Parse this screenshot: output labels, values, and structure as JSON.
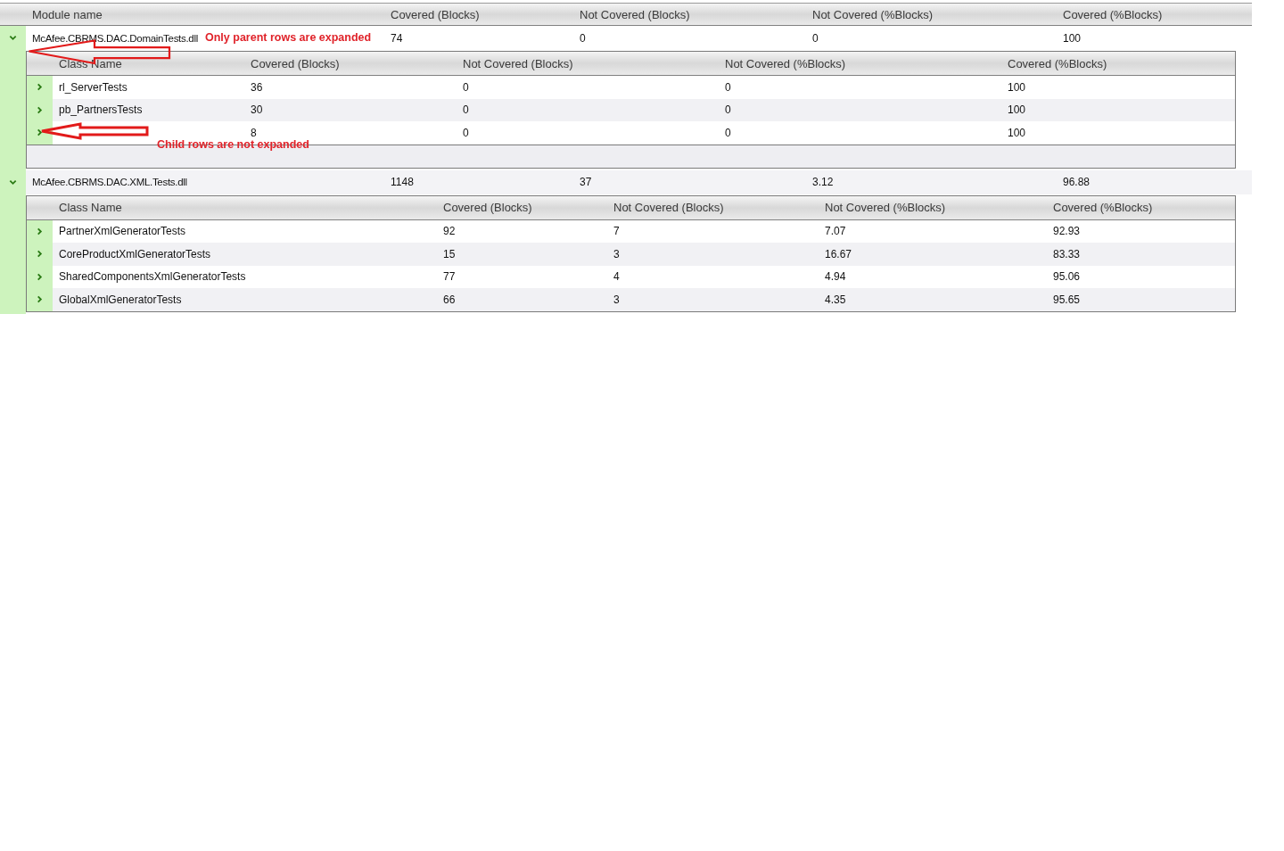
{
  "table": {
    "columns": [
      "Module name",
      "Covered (Blocks)",
      "Not Covered (Blocks)",
      "Not Covered (%Blocks)",
      "Covered (%Blocks)"
    ],
    "modules": [
      {
        "name": "McAfee.CBRMS.DAC.DomainTests.dll",
        "expanded": true,
        "covered_blocks": "74",
        "not_covered_blocks": "0",
        "not_covered_pct": "0",
        "covered_pct": "100",
        "classes": {
          "columns": [
            "Class Name",
            "Covered (Blocks)",
            "Not Covered (Blocks)",
            "Not Covered (%Blocks)",
            "Covered (%Blocks)"
          ],
          "rows": [
            {
              "name": "rl_ServerTests",
              "expanded": false,
              "covered_blocks": "36",
              "not_covered_blocks": "0",
              "not_covered_pct": "0",
              "covered_pct": "100"
            },
            {
              "name": "pb_PartnersTests",
              "expanded": false,
              "covered_blocks": "30",
              "not_covered_blocks": "0",
              "not_covered_pct": "0",
              "covered_pct": "100"
            },
            {
              "expanded": false,
              "covered_blocks": "8",
              "not_covered_blocks": "0",
              "not_covered_pct": "0",
              "covered_pct": "100"
            }
          ]
        }
      },
      {
        "name": "McAfee.CBRMS.DAC.XML.Tests.dll",
        "expanded": true,
        "covered_blocks": "1148",
        "not_covered_blocks": "37",
        "not_covered_pct": "3.12",
        "covered_pct": "96.88",
        "classes": {
          "columns": [
            "Class Name",
            "Covered (Blocks)",
            "Not Covered (Blocks)",
            "Not Covered (%Blocks)",
            "Covered (%Blocks)"
          ],
          "rows": [
            {
              "name": "PartnerXmlGeneratorTests",
              "expanded": false,
              "covered_blocks": "92",
              "not_covered_blocks": "7",
              "not_covered_pct": "7.07",
              "covered_pct": "92.93"
            },
            {
              "name": "CoreProductXmlGeneratorTests",
              "expanded": false,
              "covered_blocks": "15",
              "not_covered_blocks": "3",
              "not_covered_pct": "16.67",
              "covered_pct": "83.33"
            },
            {
              "name": "SharedComponentsXmlGeneratorTests",
              "expanded": false,
              "covered_blocks": "77",
              "not_covered_blocks": "4",
              "not_covered_pct": "4.94",
              "covered_pct": "95.06"
            },
            {
              "name": "GlobalXmlGeneratorTests",
              "expanded": false,
              "covered_blocks": "66",
              "not_covered_blocks": "3",
              "not_covered_pct": "4.35",
              "covered_pct": "95.65"
            }
          ]
        }
      }
    ]
  },
  "annotations": [
    {
      "text": "Only parent rows are expanded"
    },
    {
      "text": "Child rows are not expanded"
    }
  ]
}
